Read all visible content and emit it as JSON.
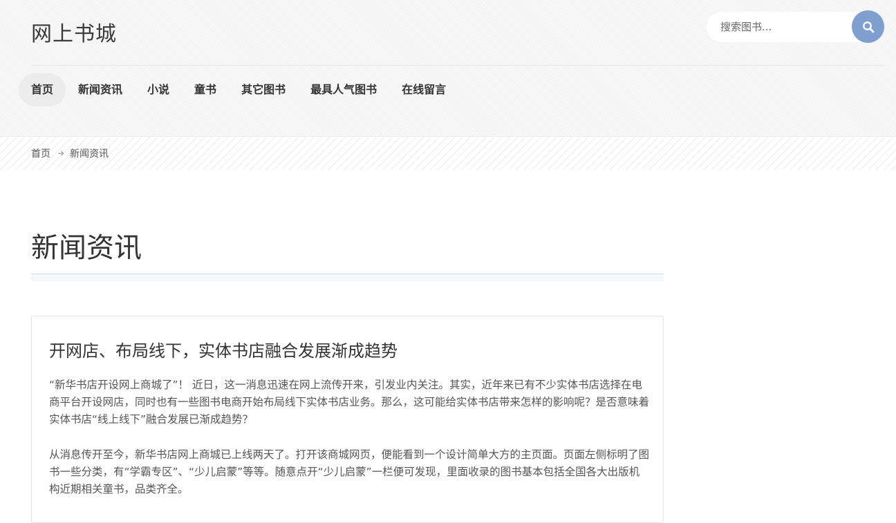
{
  "site": {
    "logo": "网上书城"
  },
  "search": {
    "placeholder": "搜索图书..."
  },
  "nav": {
    "items": [
      {
        "label": "首页",
        "active": true
      },
      {
        "label": "新闻资讯",
        "active": false
      },
      {
        "label": "小说",
        "active": false
      },
      {
        "label": "童书",
        "active": false
      },
      {
        "label": "其它图书",
        "active": false
      },
      {
        "label": "最具人气图书",
        "active": false
      },
      {
        "label": "在线留言",
        "active": false
      }
    ]
  },
  "breadcrumb": {
    "home": "首页",
    "current": "新闻资讯"
  },
  "page": {
    "title": "新闻资讯"
  },
  "article": {
    "title": "开网店、布局线下，实体书店融合发展渐成趋势",
    "paragraphs": [
      "“新华书店开设网上商城了”！ 近日，这一消息迅速在网上流传开来，引发业内关注。其实，近年来已有不少实体书店选择在电商平台开设网店，同时也有一些图书电商开始布局线下实体书店业务。那么，这可能给实体书店带来怎样的影响呢？是否意味着实体书店“线上线下”融合发展已渐成趋势？",
      "从消息传开至今，新华书店网上商城已上线两天了。打开该商城网页，便能看到一个设计简单大方的主页面。页面左侧标明了图书一些分类，有“学霸专区”、“少儿启蒙”等等。随意点开“少儿启蒙”一栏便可发现，里面收录的图书基本包括全国各大出版机构近期相关童书，品类齐全。"
    ]
  },
  "colors": {
    "accent": "#7f9fcf",
    "header_bg": "#f7f7f7",
    "nav_active_bg": "#ececec"
  },
  "icons": {
    "search": "search-icon",
    "breadcrumb_separator": "arrow-right-icon"
  }
}
